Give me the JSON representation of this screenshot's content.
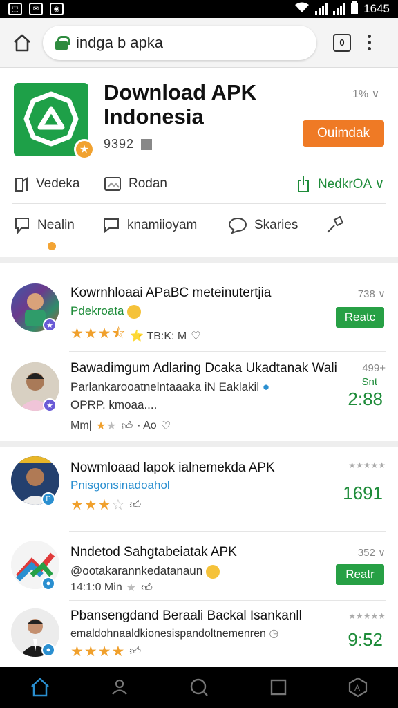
{
  "status": {
    "time": "1645"
  },
  "browser": {
    "url": "indga b apka",
    "tab_count": "0"
  },
  "hero": {
    "title": "Download APK Indonesia",
    "rating": "9392",
    "count": "1% ∨",
    "install_label": "Ouimdak",
    "actions1": [
      "Vedeka",
      "Rodan",
      "NedkrOA ∨"
    ],
    "actions2": [
      "Nealin",
      "knamiioyam",
      "Skaries"
    ]
  },
  "items": [
    {
      "title": "Kowrnhloaai APaBC meteinutertjia",
      "sub": "Pdekroata",
      "meta": "⭐ TB:K: M",
      "right_top": "738 ∨",
      "button": "Reatc",
      "stars": 3.5
    },
    {
      "title": "Bawadimgum Adlaring Dcaka Ukadtanak Wali",
      "sub": "Parlankarooatnelntaaaka iN Eaklakil",
      "sub2": "OPRP. kmoaa....",
      "meta": "Mm|",
      "right_top": "499+",
      "right_mid": "Snt",
      "big": "2:88",
      "stars": 1
    },
    {
      "title": "Nowmloaad lapok ialnemekda APK",
      "sub": "Pnisgonsinadoahol",
      "right_top": "★★★★★",
      "big": "1691",
      "stars": 3
    },
    {
      "title": "Nndetod Sahgtabeiatak APK",
      "sub": "@ootakarannkedatanaun",
      "meta": "14:1:0 Min",
      "right_top": "352 ∨",
      "button": "Reatr",
      "stars": 1
    },
    {
      "title": "Pbansengdand Beraali Backal Isankanll",
      "sub": "emaldohnaaldkionesispandoltnemenren",
      "right_top": "★★★★★",
      "big": "9:52",
      "stars": 4
    }
  ]
}
